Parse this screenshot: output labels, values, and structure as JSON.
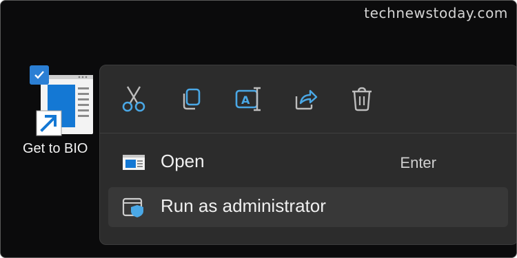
{
  "watermark": "technewstoday.com",
  "desktop": {
    "shortcut_label": "Get to BIO",
    "selected": true
  },
  "context_menu": {
    "toolbar": [
      {
        "name": "cut",
        "icon": "scissors-icon"
      },
      {
        "name": "copy",
        "icon": "copy-icon"
      },
      {
        "name": "rename",
        "icon": "rename-icon"
      },
      {
        "name": "share",
        "icon": "share-icon"
      },
      {
        "name": "delete",
        "icon": "trash-icon"
      }
    ],
    "items": [
      {
        "label": "Open",
        "shortcut": "Enter",
        "icon": "open-window-icon"
      },
      {
        "label": "Run as administrator",
        "shortcut": "",
        "icon": "shield-window-icon"
      }
    ]
  },
  "colors": {
    "desktop_bg": "#0b0b0c",
    "menu_bg": "#2c2c2c",
    "accent": "#4aa8e6",
    "hover": "#383838"
  }
}
